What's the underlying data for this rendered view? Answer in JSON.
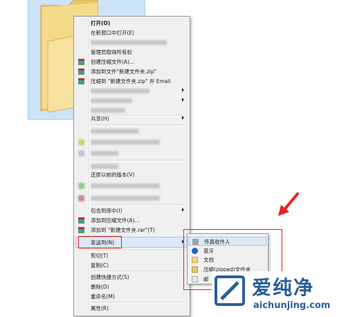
{
  "menu": {
    "items": [
      {
        "label": "打开(O)",
        "bold": true
      },
      {
        "label": "在新窗口中打开(E)"
      },
      {
        "label": ""
      },
      {
        "label": "管理员取得所有权"
      },
      {
        "label": "创建压缩文件(A)..."
      },
      {
        "label": "添加到文件\"新建文件夹.zip\""
      },
      {
        "label": "压缩到 \"新建文件夹.zip\" 并 Email"
      },
      {
        "label": "共享(H)"
      },
      {
        "label": "还原以前的版本(V)"
      },
      {
        "label": "包含到库中(I)"
      },
      {
        "label": "添加到压缩文件(A)..."
      },
      {
        "label": "添加到 \"新建文件夹.rar\"(T)"
      },
      {
        "label": "发送到(N)"
      },
      {
        "label": "剪切(T)"
      },
      {
        "label": "复制(C)"
      },
      {
        "label": "创建快捷方式(S)"
      },
      {
        "label": "删除(D)"
      },
      {
        "label": "重命名(M)"
      },
      {
        "label": "属性(R)"
      }
    ]
  },
  "submenu": {
    "items": [
      {
        "label": "传真收件人"
      },
      {
        "label": "蓝牙"
      },
      {
        "label": "文档"
      },
      {
        "label": "压缩(zipped)文件夹"
      },
      {
        "label": "邮"
      }
    ]
  },
  "watermark": {
    "title": "爱纯净",
    "url": "aichunjing.com"
  },
  "colors": {
    "highlight": "#dbe9f7",
    "annotation_red": "#e8201a",
    "watermark_blue": "#2a5f9a"
  }
}
